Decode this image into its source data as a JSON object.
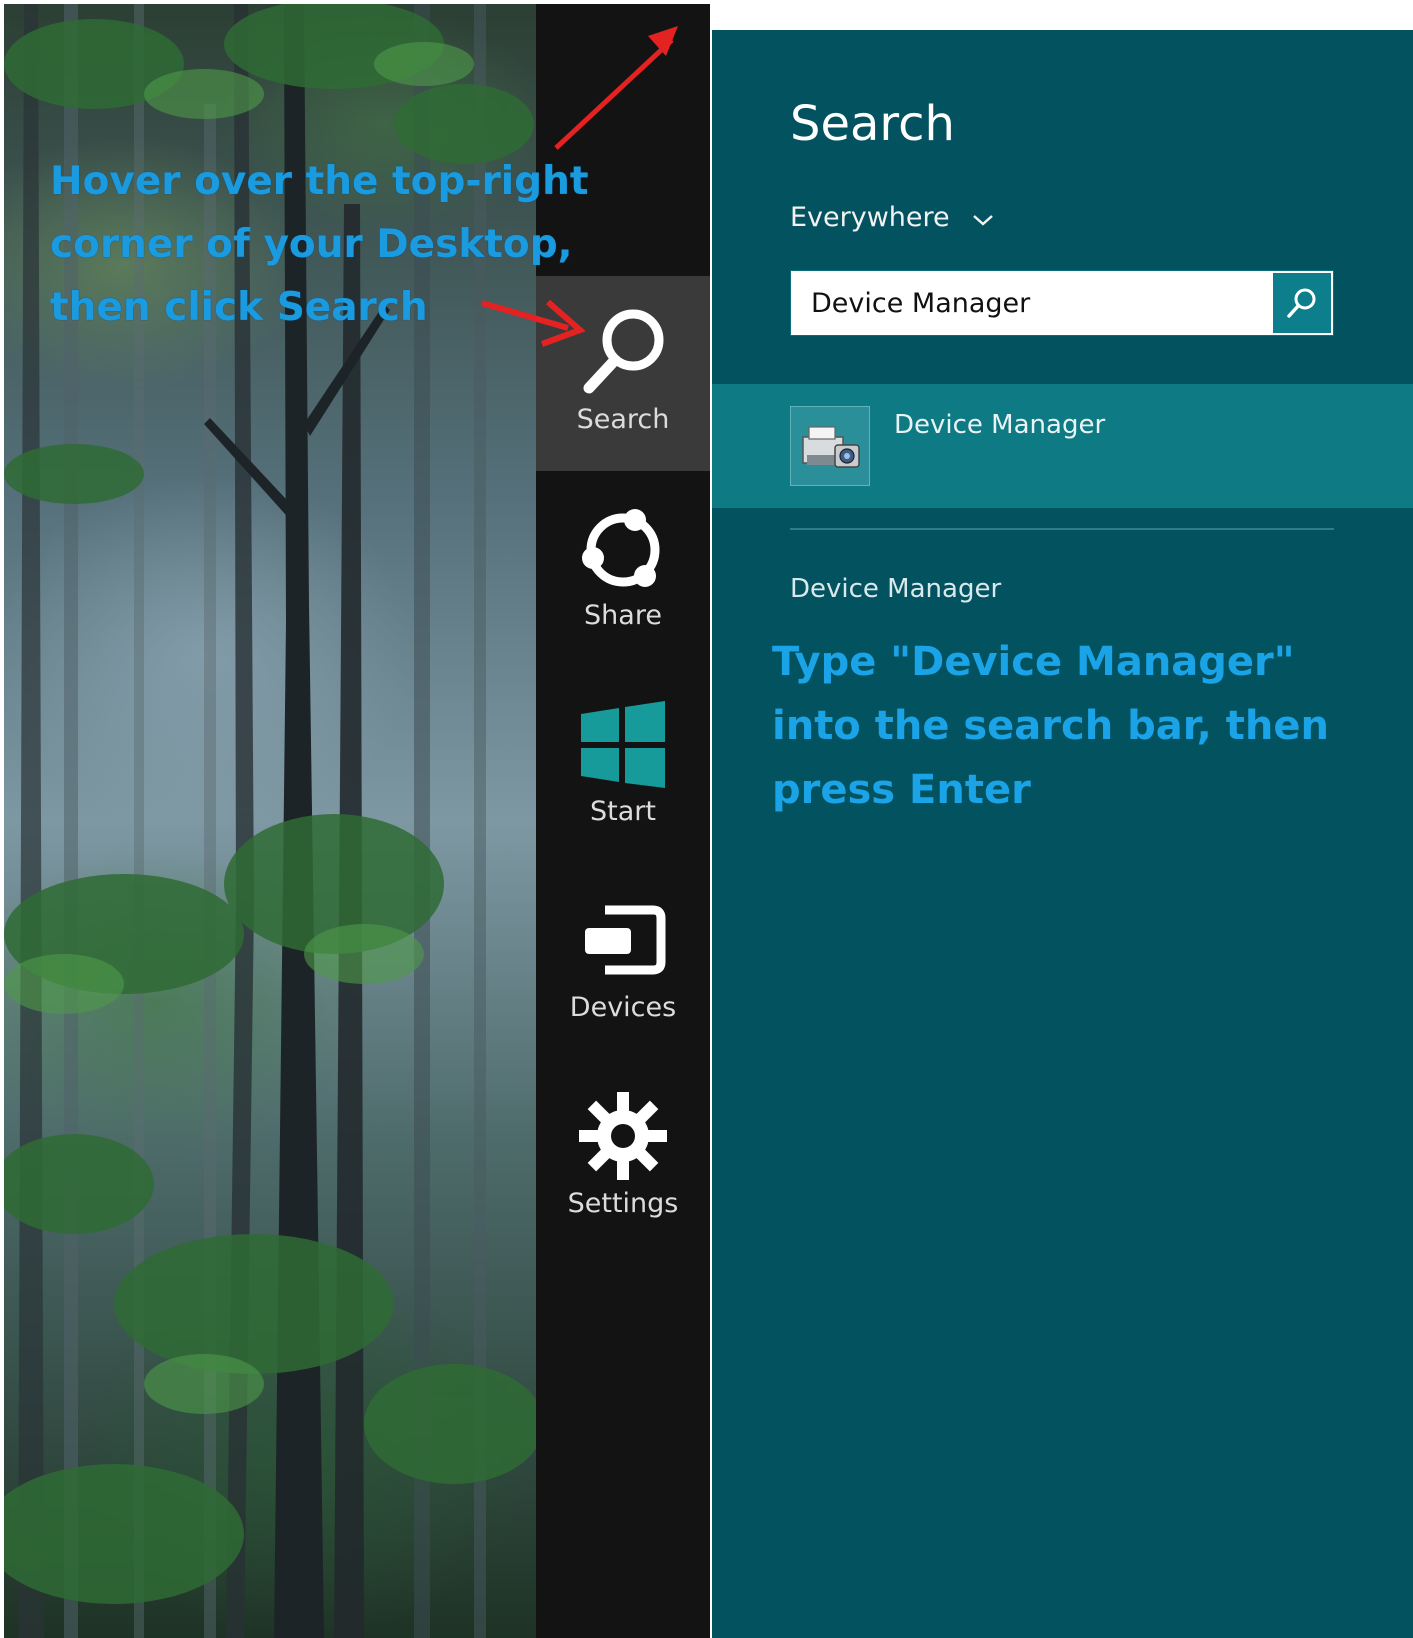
{
  "desktop": {
    "annotation_lines": [
      "Hover over the top-right",
      "corner of your Desktop,",
      "then click Search"
    ]
  },
  "charms": {
    "items": [
      {
        "label": "Search",
        "icon": "search-icon"
      },
      {
        "label": "Share",
        "icon": "share-icon"
      },
      {
        "label": "Start",
        "icon": "windows-logo-icon"
      },
      {
        "label": "Devices",
        "icon": "devices-icon"
      },
      {
        "label": "Settings",
        "icon": "gear-icon"
      }
    ],
    "active": "Search"
  },
  "search_pane": {
    "title": "Search",
    "scope": "Everywhere",
    "query": "Device Manager",
    "result": {
      "title": "Device Manager",
      "icon": "device-manager-icon"
    },
    "suggestion": "Device Manager",
    "annotation_lines": [
      "Type \"Device Manager\"",
      "into the search bar, then",
      "press Enter"
    ]
  },
  "colors": {
    "pane_bg": "#035260",
    "result_highlight": "#0e7a84",
    "charms_bg": "#131313",
    "annotation_text": "#1a9be0",
    "arrow": "#e52222",
    "start_tile": "#179a9a"
  }
}
